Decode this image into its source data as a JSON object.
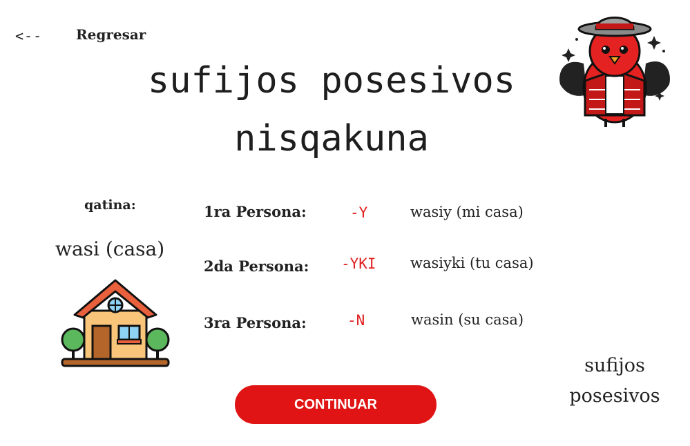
{
  "nav": {
    "back_arrow": "<--",
    "back_label": "Regresar"
  },
  "title": {
    "line1": "sufijos posesivos",
    "line2": "nisqakuna"
  },
  "example": {
    "label": "qatina:",
    "word": "wasi (casa)"
  },
  "rows": [
    {
      "persona": "1ra Persona:",
      "suffix": "-Y",
      "translation": "wasiy (mi casa)"
    },
    {
      "persona": "2da Persona:",
      "suffix": "-YKI",
      "translation": "wasiyki (tu casa)"
    },
    {
      "persona": "3ra Persona:",
      "suffix": "-N",
      "translation": "wasin (su casa)"
    }
  ],
  "side_label": {
    "line1": "sufijos",
    "line2": "posesivos"
  },
  "button": {
    "label": "CONTINUAR"
  },
  "colors": {
    "accent": "#e01414",
    "suffix": "#e01e1e",
    "text": "#222222"
  },
  "icons": {
    "mascot": "bird-mascot-icon",
    "house": "house-icon",
    "back": "back-arrow-icon"
  }
}
